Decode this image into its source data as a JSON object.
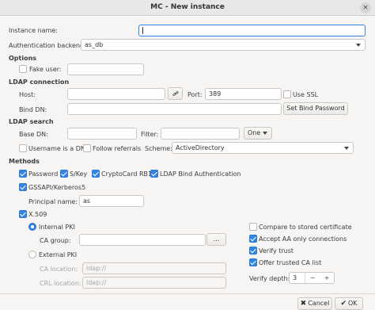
{
  "window": {
    "title": "MC - New instance",
    "close_glyph": "×"
  },
  "instance": {
    "label": "Instance name:",
    "value": ""
  },
  "auth": {
    "label": "Authentication backend:",
    "value": "as_db"
  },
  "options": {
    "title": "Options",
    "fake_user_label": "Fake user:",
    "fake_user_checked": false
  },
  "ldap_connection": {
    "title": "LDAP connection",
    "host_label": "Host:",
    "host_value": "",
    "port_label": "Port:",
    "port_value": "389",
    "use_ssl_label": "Use SSL",
    "use_ssl_checked": false,
    "bind_dn_label": "Bind DN:",
    "bind_dn_value": "",
    "set_bind_password_label": "Set Bind Password"
  },
  "ldap_search": {
    "title": "LDAP search",
    "base_dn_label": "Base DN:",
    "base_dn_value": "",
    "filter_label": "Filter:",
    "filter_value": "",
    "scope_value": "One",
    "username_is_dn_label": "Username is a DN",
    "username_is_dn_checked": false,
    "follow_referrals_label": "Follow referrals",
    "follow_referrals_checked": false,
    "scheme_label": "Scheme:",
    "scheme_value": "ActiveDirectory"
  },
  "methods": {
    "title": "Methods",
    "password_label": "Password",
    "password_checked": true,
    "skey_label": "S/Key",
    "skey_checked": true,
    "cryptocard_label": "CryptoCard RB1",
    "cryptocard_checked": true,
    "ldap_bind_label": "LDAP Bind Authentication",
    "ldap_bind_checked": true,
    "gssapi_label": "GSSAPI/Kerberos5",
    "gssapi_checked": true,
    "principal_label": "Principal name:",
    "principal_value": "as",
    "x509_label": "X.509",
    "x509_checked": true,
    "internal_pki_label": "Internal PKI",
    "internal_pki_selected": true,
    "ca_group_label": "CA group:",
    "ca_group_value": "",
    "ca_group_button": "...",
    "external_pki_label": "External PKI",
    "external_pki_selected": false,
    "ca_location_label": "CA location:",
    "ca_location_placeholder": "ldap://",
    "crl_location_label": "CRL location:",
    "crl_location_placeholder": "ldap://",
    "compare_cert_label": "Compare to stored certificate",
    "compare_cert_checked": false,
    "accept_aa_label": "Accept AA only connections",
    "accept_aa_checked": true,
    "verify_trust_label": "Verify trust",
    "verify_trust_checked": true,
    "offer_ca_label": "Offer trusted CA list",
    "offer_ca_checked": true,
    "verify_depth_label": "Verify depth:",
    "verify_depth_value": "3",
    "minus_glyph": "−",
    "plus_glyph": "+"
  },
  "footer": {
    "cancel_label": "Cancel",
    "ok_label": "OK",
    "cancel_icon": "✖",
    "ok_icon": "✔"
  },
  "colors": {
    "accent": "#3584e4",
    "background": "#f6f5f4"
  }
}
